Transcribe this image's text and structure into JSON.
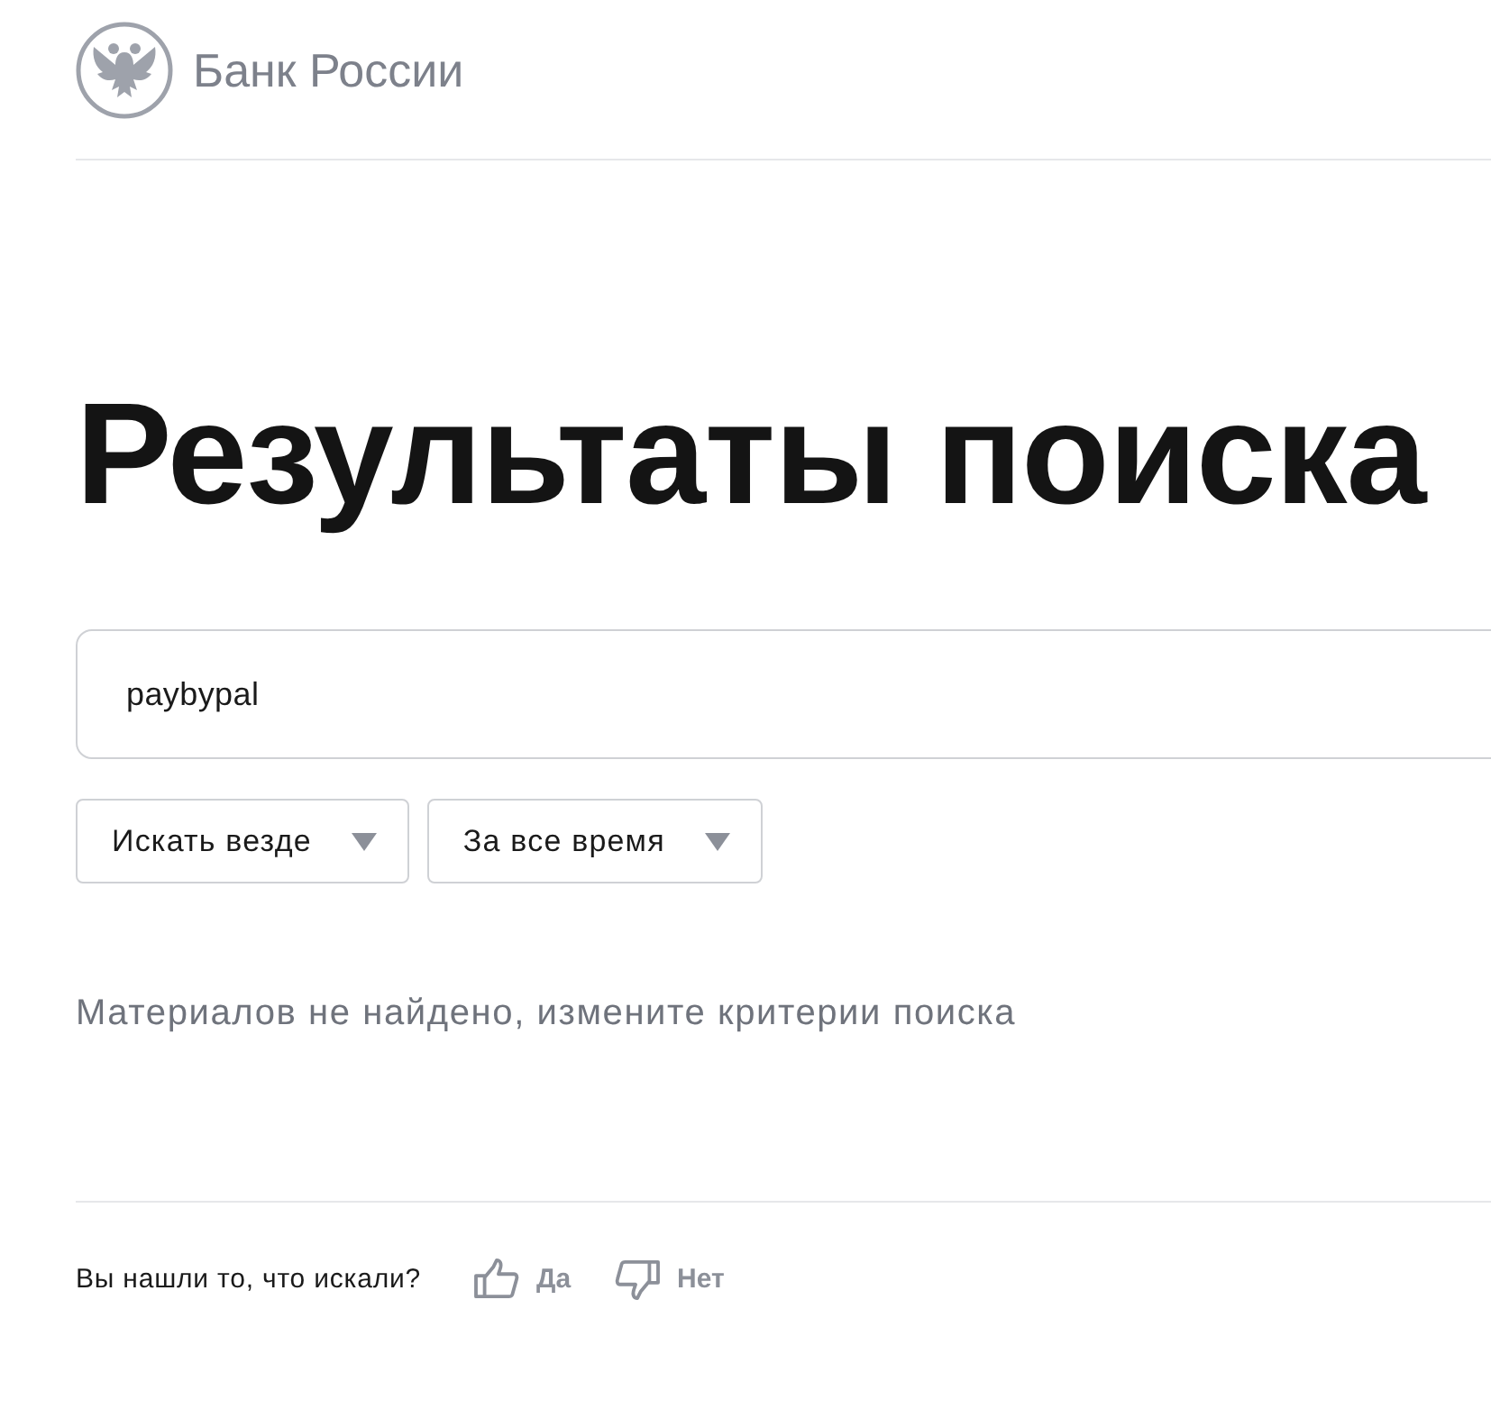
{
  "header": {
    "logo_text": "Банк России"
  },
  "title": "Результаты поиска",
  "search": {
    "value": "paybypal"
  },
  "filters": [
    {
      "label": "Искать везде"
    },
    {
      "label": "За все время"
    }
  ],
  "message": "Материалов не найдено, измените критерии поиска",
  "feedback": {
    "question": "Вы нашли то, что искали?",
    "answers": [
      {
        "kind": "yes",
        "label": "Да"
      },
      {
        "kind": "no",
        "label": "Нет"
      }
    ]
  }
}
